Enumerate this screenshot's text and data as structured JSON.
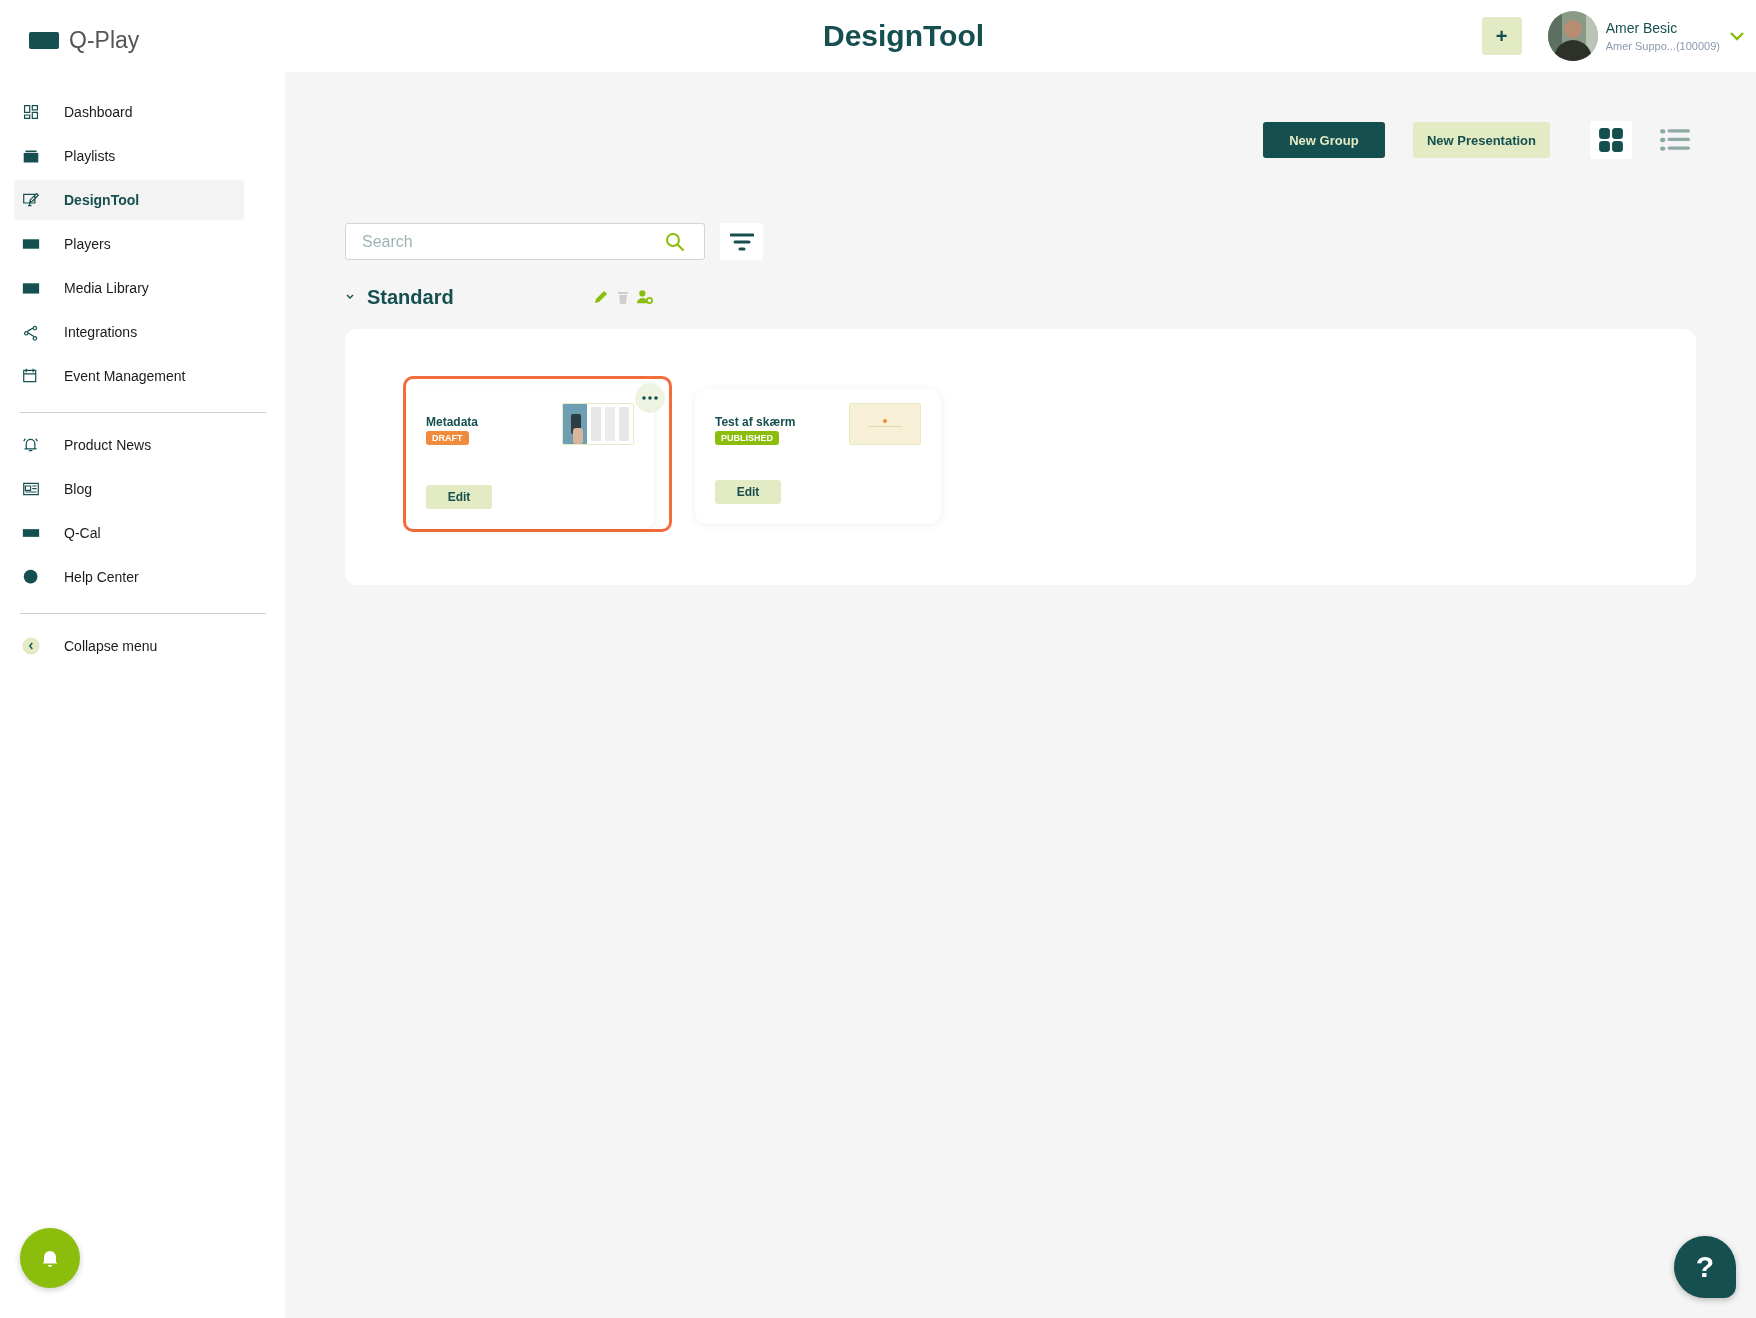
{
  "app": {
    "name": "Q-Play"
  },
  "header": {
    "title": "DesignTool",
    "add_button": "+",
    "user": {
      "name": "Amer Besic",
      "account": "Amer Suppo...(100009)"
    }
  },
  "sidebar": {
    "sections": [
      {
        "items": [
          {
            "label": "Dashboard",
            "selected": false
          },
          {
            "label": "Playlists",
            "selected": false
          },
          {
            "label": "DesignTool",
            "selected": true
          },
          {
            "label": "Players",
            "selected": false
          },
          {
            "label": "Media Library",
            "selected": false
          },
          {
            "label": "Integrations",
            "selected": false
          },
          {
            "label": "Event Management",
            "selected": false
          }
        ]
      },
      {
        "items": [
          {
            "label": "Product News",
            "selected": false
          },
          {
            "label": "Blog",
            "selected": false
          },
          {
            "label": "Q-Cal",
            "selected": false
          },
          {
            "label": "Help Center",
            "selected": false
          }
        ]
      }
    ],
    "collapse": "Collapse menu"
  },
  "toolbar": {
    "buttons": [
      {
        "label": "New Group",
        "kind": "primary"
      },
      {
        "label": "New Presentation",
        "kind": "secondary"
      }
    ],
    "views": [
      {
        "kind": "grid",
        "selected": true
      },
      {
        "kind": "list",
        "selected": false
      }
    ]
  },
  "search": {
    "placeholder": "Search"
  },
  "group": {
    "name": "Standard",
    "expanded": true,
    "presentations": [
      {
        "title": "Metadata",
        "status": "DRAFT",
        "color": "#f08a3c",
        "selected": true,
        "button": "Edit"
      },
      {
        "title": "Test af skærm",
        "status": "PUBLISHED",
        "color": "#8bbd0d",
        "selected": false,
        "button": "Edit"
      }
    ]
  },
  "help_button": "?"
}
